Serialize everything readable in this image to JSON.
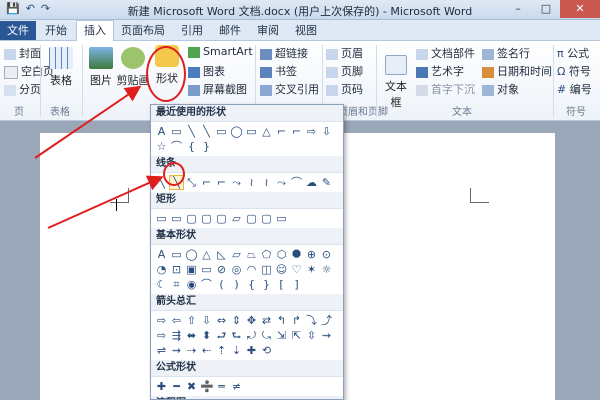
{
  "window": {
    "title": "新建 Microsoft Word 文档.docx (用户上次保存的) - Microsoft Word"
  },
  "quick_access": {
    "save": "💾",
    "undo": "↶",
    "redo": "↷"
  },
  "window_buttons": {
    "minimize": "–",
    "maximize": "□",
    "close": "✕"
  },
  "tabs": [
    "文件",
    "开始",
    "插入",
    "页面布局",
    "引用",
    "邮件",
    "审阅",
    "视图"
  ],
  "ribbon": {
    "pages_group": {
      "label": "页",
      "items": [
        "封面",
        "空白页",
        "分页"
      ]
    },
    "table_group": {
      "label": "表格",
      "button": "表格"
    },
    "illustrations": {
      "picture": "图片",
      "clipart": "剪贴画",
      "shapes": "形状",
      "smartart": "SmartArt",
      "chart": "图表",
      "screenshot": "屏幕截图"
    },
    "links": {
      "hyperlink": "超链接",
      "bookmark": "书签",
      "crossref": "交叉引用"
    },
    "header_footer": {
      "label": "页眉和页脚",
      "header": "页眉",
      "footer": "页脚",
      "pagenum": "页码"
    },
    "text_group": {
      "label": "文本",
      "textbox": "文本框",
      "docparts": "文档部件",
      "wordart": "艺术字",
      "dropcap": "首字下沉",
      "signature": "签名行",
      "datetime": "日期和时间",
      "object": "对象"
    },
    "symbols_group": {
      "label": "符号",
      "equation": "公式",
      "symbol": "符号",
      "number": "编号"
    }
  },
  "shapes_menu": {
    "sections": [
      {
        "title": "最近使用的形状",
        "glyphs": [
          "A",
          "▭",
          "╲",
          "╲",
          "▭",
          "◯",
          "▭",
          "△",
          "⌐",
          "⌐",
          "⇨",
          "⇩",
          "☆",
          "⌒",
          "{",
          "}"
        ]
      },
      {
        "title": "线条",
        "glyphs": [
          "╲",
          "╲",
          "⤡",
          "⌐",
          "⌐",
          "⤳",
          "≀",
          "≀",
          "⤳",
          "⌒",
          "☁",
          "✎"
        ]
      },
      {
        "title": "矩形",
        "glyphs": [
          "▭",
          "▭",
          "▢",
          "▢",
          "▢",
          "▱",
          "▢",
          "▢",
          "▭"
        ]
      },
      {
        "title": "基本形状",
        "glyphs": [
          "A",
          "▭",
          "◯",
          "△",
          "◺",
          "▱",
          "⏢",
          "⬠",
          "⬡",
          "⯃",
          "⊕",
          "⊙",
          "◔",
          "⊡",
          "▣",
          "▭",
          "⊘",
          "◎",
          "◠",
          "◫",
          "☺",
          "♡",
          "✶",
          "☼",
          "☾",
          "⌗",
          "◉",
          "⌒",
          "(",
          ")",
          "{",
          "}",
          "[",
          "]"
        ]
      },
      {
        "title": "箭头总汇",
        "glyphs": [
          "⇨",
          "⇦",
          "⇧",
          "⇩",
          "⇔",
          "⇕",
          "✥",
          "⇄",
          "↰",
          "↱",
          "⤵",
          "⤴",
          "⇨",
          "⇶",
          "⬌",
          "⬍",
          "⮐",
          "⮑",
          "⤾",
          "⤿",
          "⇲",
          "⇱",
          "⇳",
          "⇝",
          "⇌",
          "⇝",
          "⇢",
          "⇠",
          "⇡",
          "⇣",
          "✚",
          "⟲"
        ]
      },
      {
        "title": "公式形状",
        "glyphs": [
          "✚",
          "━",
          "✖",
          "➗",
          "═",
          "≠"
        ]
      },
      {
        "title": "流程图",
        "glyphs": []
      }
    ]
  }
}
